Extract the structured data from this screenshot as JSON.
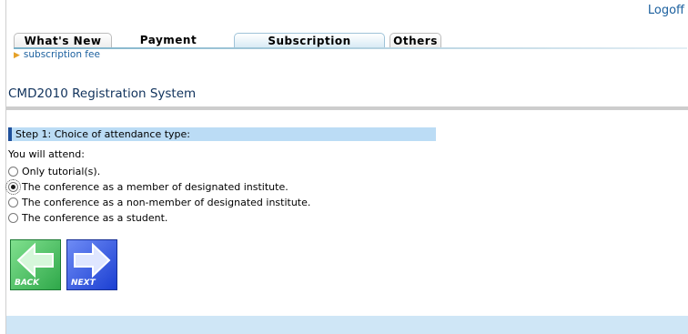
{
  "header": {
    "logoff": "Logoff"
  },
  "tabs": [
    {
      "label": "What's New"
    },
    {
      "label": "Payment"
    },
    {
      "label": "Subscription"
    },
    {
      "label": "Others"
    }
  ],
  "sublink": "subscription fee",
  "page_title": "CMD2010 Registration System",
  "step": {
    "title": "Step 1: Choice of attendance type:",
    "prompt": "You will attend:",
    "options": [
      {
        "label": "Only tutorial(s).",
        "selected": false
      },
      {
        "label": "The conference as a member of designated institute.",
        "selected": true
      },
      {
        "label": "The conference as a non-member of designated institute.",
        "selected": false
      },
      {
        "label": "The conference as a student.",
        "selected": false
      }
    ]
  },
  "buttons": {
    "back": "BACK",
    "next": "NEXT"
  },
  "icons": {
    "back": "arrow-left-icon",
    "next": "arrow-right-icon",
    "sublink": "triangle-right-icon"
  },
  "colors": {
    "link": "#1a5f9e",
    "step_header_bg": "#bbdcf5",
    "step_header_accent": "#1e4f9a",
    "back_button": "#2fa84a",
    "next_button": "#1b3fd2",
    "footer_bg": "#cfe6f6"
  }
}
